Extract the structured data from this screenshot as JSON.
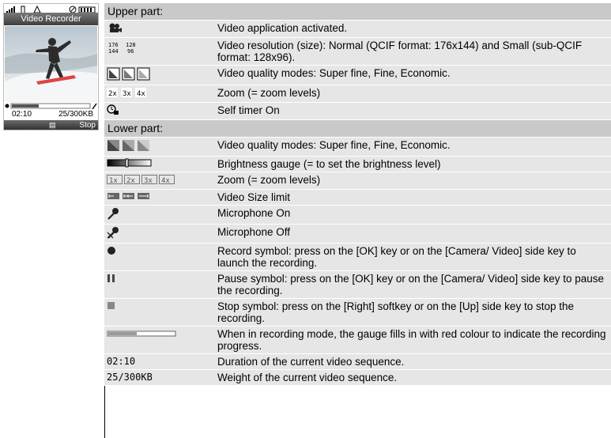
{
  "phone": {
    "title": "Video Recorder",
    "duration": "02:10",
    "weight": "25/300KB",
    "softkey_right": "Stop",
    "record_progress": 0.35
  },
  "sections": [
    {
      "title": "Upper part:",
      "rows": [
        {
          "icon": "video-camera-icon",
          "desc": "Video application activated."
        },
        {
          "icon": "resolution-icons",
          "icon_texts": [
            "176\n144",
            "128\n96"
          ],
          "desc": "Video resolution (size): Normal (QCIF format: 176x144) and Small (sub-QCIF format: 128x96)."
        },
        {
          "icon": "quality-modes-icons",
          "desc": "Video quality modes: Super fine, Fine, Economic."
        },
        {
          "icon": "zoom-levels-icons",
          "icon_texts": [
            "2x",
            "3x",
            "4x"
          ],
          "desc": "Zoom (= zoom levels)"
        },
        {
          "icon": "self-timer-icon",
          "desc": "Self timer On"
        }
      ]
    },
    {
      "title": "Lower part:",
      "rows": [
        {
          "icon": "quality-modes-icons",
          "desc": "Video quality modes: Super fine, Fine, Economic."
        },
        {
          "icon": "brightness-gauge-icon",
          "desc": "Brightness gauge (= to set the brightness level)"
        },
        {
          "icon": "zoom-boxes-icons",
          "icon_texts": [
            "1x",
            "2x",
            "3x",
            "4x"
          ],
          "desc": "Zoom (= zoom levels)"
        },
        {
          "icon": "size-limit-icons",
          "desc": "Video Size limit"
        },
        {
          "icon": "microphone-on-icon",
          "desc": "Microphone On"
        },
        {
          "icon": "microphone-off-icon",
          "desc": "Microphone Off"
        },
        {
          "icon": "record-icon",
          "desc": "Record symbol: press on the [OK] key or on the [Camera/ Video] side key to launch the recording."
        },
        {
          "icon": "pause-icon",
          "desc": "Pause symbol: press on the [OK] key or on the [Camera/ Video] side key to pause the recording."
        },
        {
          "icon": "stop-icon",
          "desc": "Stop symbol: press on the [Right] softkey or on the [Up] side key to stop the recording."
        },
        {
          "icon": "progress-gauge-icon",
          "desc": "When in recording mode, the gauge fills in with red colour to indicate the recording progress."
        },
        {
          "icon": "duration-text",
          "icon_text": "02:10",
          "desc": "Duration of the current video sequence."
        },
        {
          "icon": "weight-text",
          "icon_text": "25/300KB",
          "desc": "Weight of the current video sequence."
        }
      ]
    }
  ]
}
